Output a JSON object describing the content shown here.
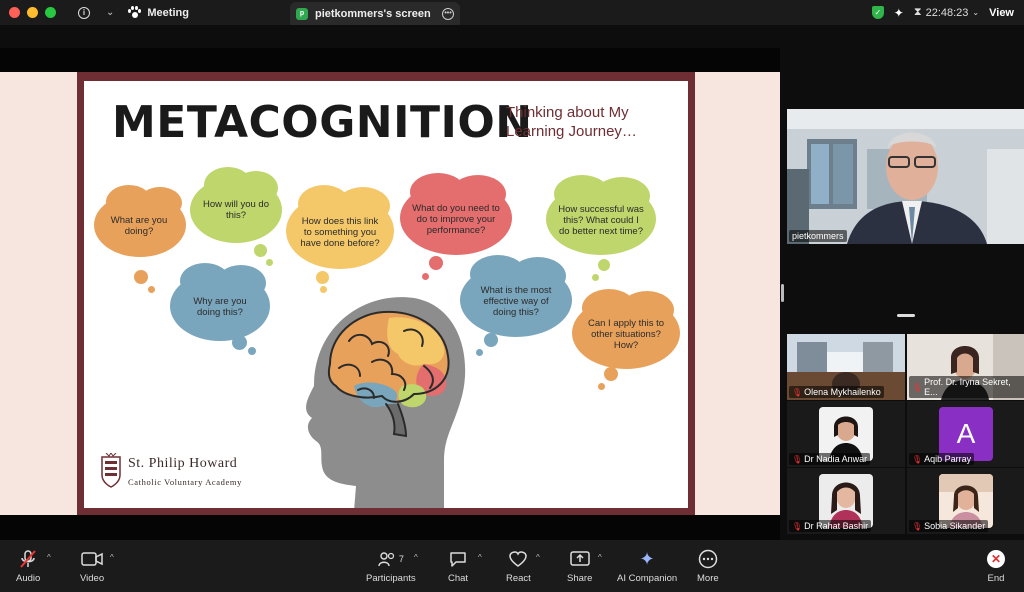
{
  "window": {
    "meeting_label": "Meeting",
    "share_tab_label": "pietkommers's screen",
    "share_tab_avatar": "p",
    "time": "22:48:23",
    "view_label": "View",
    "colors": {
      "close": "#fe5f57",
      "minimize": "#febc2e",
      "zoom": "#28c840",
      "shield": "#2fb54a"
    }
  },
  "slide": {
    "title": "METACOGNITION",
    "subtitle": "Thinking about My Learning Journey…",
    "bubbles": [
      {
        "text": "What are you doing?",
        "color": "orange"
      },
      {
        "text": "How will you do this?",
        "color": "green"
      },
      {
        "text": "How does this link to something you have done before?",
        "color": "yellow"
      },
      {
        "text": "What do you need to do to improve your performance?",
        "color": "red"
      },
      {
        "text": "How successful was this? What could I do better next time?",
        "color": "green"
      },
      {
        "text": "Why are you doing this?",
        "color": "blue"
      },
      {
        "text": "What is the most effective way of doing this?",
        "color": "blue"
      },
      {
        "text": "Can I apply this to other situations? How?",
        "color": "orange"
      }
    ],
    "school_name": "St. Philip Howard",
    "school_sub": "Catholic Voluntary Academy"
  },
  "participants_panel": {
    "speaker": {
      "name": "pietkommers"
    },
    "tiles": [
      {
        "name": "Olena Mykhailenko",
        "muted": true
      },
      {
        "name": "Prof. Dr. Iryna Sekret, E...",
        "muted": true
      },
      {
        "name": "Dr Nadia Anwar",
        "muted": true
      },
      {
        "name": "Aqib Parray",
        "muted": true,
        "letter": "A"
      },
      {
        "name": "Dr Rahat Bashir",
        "muted": true
      },
      {
        "name": "Sobia Sikander",
        "muted": true
      }
    ]
  },
  "toolbar": {
    "audio": "Audio",
    "video": "Video",
    "participants": "Participants",
    "participants_count": "7",
    "chat": "Chat",
    "react": "React",
    "share": "Share",
    "ai_companion": "AI Companion",
    "more": "More",
    "end": "End"
  }
}
